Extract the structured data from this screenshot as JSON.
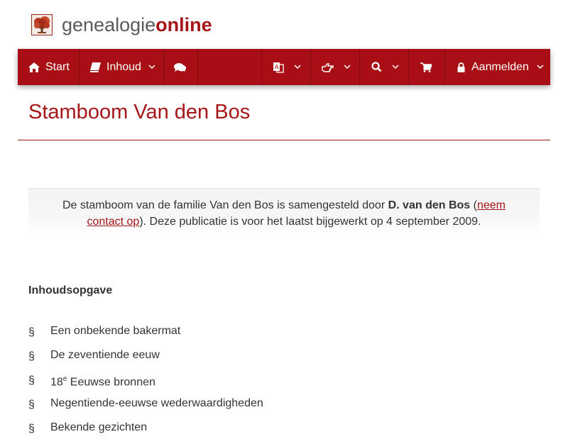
{
  "logo": {
    "part1": "genealogie",
    "part2": "online"
  },
  "nav": {
    "start": "Start",
    "inhoud": "Inhoud",
    "aanmelden": "Aanmelden"
  },
  "page": {
    "title": "Stamboom Van den Bos"
  },
  "intro": {
    "text1": "De stamboom van de familie Van den Bos is samengesteld door ",
    "author": "D. van den Bos",
    "paren_open": " (",
    "link_part1": "neem",
    "link_part2": "contact op",
    "text2": "). Deze publicatie is voor het laatst bijgewerkt op 4 september 2009."
  },
  "toc": {
    "heading": "Inhoudsopgave",
    "bullet": "§",
    "items": [
      {
        "text": "Een onbekende bakermat"
      },
      {
        "text": "De zeventiende eeuw"
      },
      {
        "pre": "18",
        "sup": "e",
        "post": " Eeuwse bronnen"
      },
      {
        "text": "Negentiende-eeuwse wederwaardigheden"
      },
      {
        "text": "Bekende gezichten"
      }
    ]
  },
  "colors": {
    "brand": "#a61517",
    "navbar": "#a80f14"
  },
  "icons": [
    "tree-logo-icon",
    "home-icon",
    "book-icon",
    "comments-icon",
    "language-icon",
    "pointing-hand-icon",
    "search-icon",
    "cart-icon",
    "lock-icon",
    "chevron-down-icon"
  ]
}
